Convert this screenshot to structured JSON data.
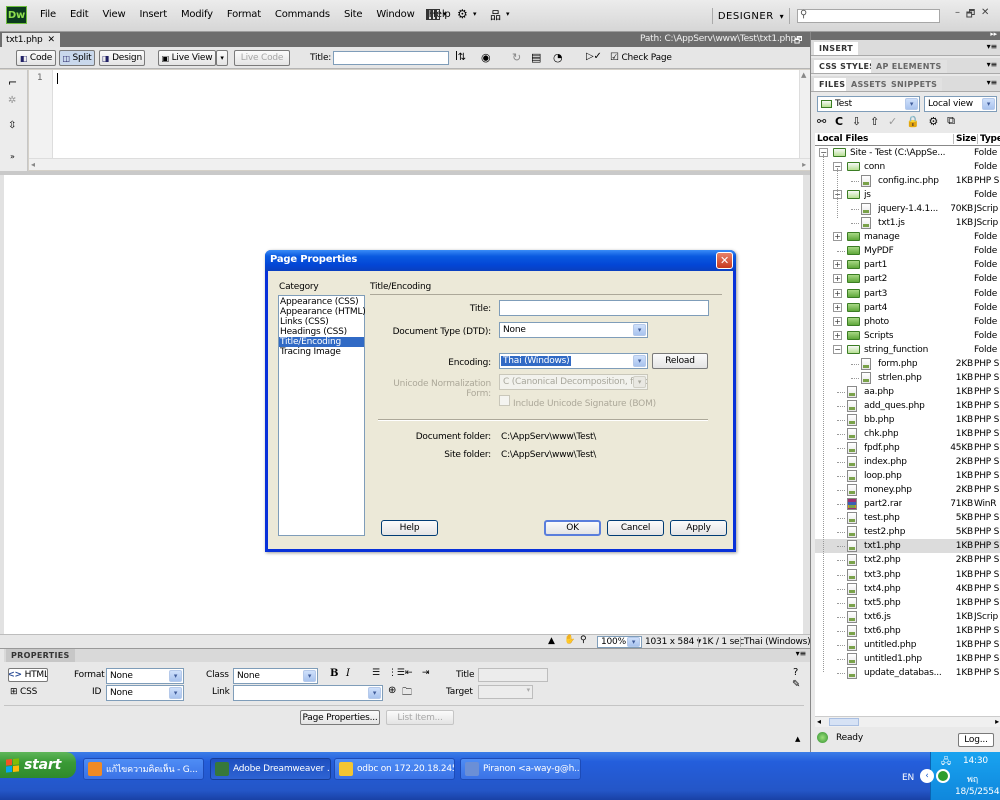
{
  "app": {
    "logo": "Dw",
    "menu": [
      "File",
      "Edit",
      "View",
      "Insert",
      "Modify",
      "Format",
      "Commands",
      "Site",
      "Window",
      "Help"
    ],
    "workspace": "DESIGNER",
    "window_controls": [
      "–",
      "🗗",
      "✕"
    ]
  },
  "document": {
    "tab_name": "txt1.php",
    "path": "Path:  C:\\AppServ\\www\\Test\\txt1.php",
    "view_buttons": {
      "code": "Code",
      "split": "Split",
      "design": "Design",
      "live_view": "Live View",
      "live_code": "Live Code"
    },
    "title_label": "Title:",
    "title_value": "",
    "check_page": "Check Page",
    "line_number": "1"
  },
  "status_bar": {
    "zoom": "100%",
    "size": "1031 x 584",
    "download": "1K / 1 sec",
    "encoding": "Thai (Windows)"
  },
  "dialog": {
    "title": "Page Properties",
    "category_label": "Category",
    "section_label": "Title/Encoding",
    "categories": [
      "Appearance (CSS)",
      "Appearance (HTML)",
      "Links (CSS)",
      "Headings (CSS)",
      "Title/Encoding",
      "Tracing Image"
    ],
    "selected_category": 4,
    "title_label": "Title:",
    "title_value": "",
    "doctype_label": "Document Type (DTD):",
    "doctype_value": "None",
    "encoding_label": "Encoding:",
    "encoding_value": "Thai (Windows)",
    "reload": "Reload",
    "unicode_label": "Unicode Normalization Form:",
    "unicode_value": "C (Canonical Decomposition, follow",
    "bom_label": "Include Unicode Signature (BOM)",
    "doc_folder_label": "Document folder:",
    "doc_folder_value": "C:\\AppServ\\www\\Test\\",
    "site_folder_label": "Site folder:",
    "site_folder_value": "C:\\AppServ\\www\\Test\\",
    "help": "Help",
    "ok": "OK",
    "cancel": "Cancel",
    "apply": "Apply"
  },
  "properties": {
    "header": "PROPERTIES",
    "html_btn": "HTML",
    "css_btn": "CSS",
    "format_label": "Format",
    "format_value": "None",
    "id_label": "ID",
    "id_value": "None",
    "class_label": "Class",
    "class_value": "None",
    "link_label": "Link",
    "title_label": "Title",
    "target_label": "Target",
    "page_properties": "Page Properties...",
    "list_item": "List Item..."
  },
  "panels": {
    "insert": "INSERT",
    "css_styles": "CSS STYLES",
    "ap_elements": "AP ELEMENTS",
    "files": "FILES",
    "assets": "ASSETS",
    "snippets": "SNIPPETS",
    "site_select": "Test",
    "view_select": "Local view",
    "col_local": "Local Files",
    "col_size": "Size",
    "col_type": "Type",
    "ready": "Ready",
    "log": "Log..."
  },
  "files": [
    {
      "name": "Site - Test (C:\\AppSe...",
      "size": "",
      "type": "Folde",
      "depth": 0,
      "kind": "folder-open",
      "exp": "-"
    },
    {
      "name": "conn",
      "size": "",
      "type": "Folde",
      "depth": 1,
      "kind": "folder-open",
      "exp": "-"
    },
    {
      "name": "config.inc.php",
      "size": "1KB",
      "type": "PHP S",
      "depth": 2,
      "kind": "file",
      "exp": ""
    },
    {
      "name": "js",
      "size": "",
      "type": "Folde",
      "depth": 1,
      "kind": "folder-open",
      "exp": "-"
    },
    {
      "name": "jquery-1.4.1...",
      "size": "70KB",
      "type": "JScrip",
      "depth": 2,
      "kind": "file",
      "exp": ""
    },
    {
      "name": "txt1.js",
      "size": "1KB",
      "type": "JScrip",
      "depth": 2,
      "kind": "file",
      "exp": ""
    },
    {
      "name": "manage",
      "size": "",
      "type": "Folde",
      "depth": 1,
      "kind": "folder",
      "exp": "+"
    },
    {
      "name": "MyPDF",
      "size": "",
      "type": "Folde",
      "depth": 1,
      "kind": "folder",
      "exp": ""
    },
    {
      "name": "part1",
      "size": "",
      "type": "Folde",
      "depth": 1,
      "kind": "folder",
      "exp": "+"
    },
    {
      "name": "part2",
      "size": "",
      "type": "Folde",
      "depth": 1,
      "kind": "folder",
      "exp": "+"
    },
    {
      "name": "part3",
      "size": "",
      "type": "Folde",
      "depth": 1,
      "kind": "folder",
      "exp": "+"
    },
    {
      "name": "part4",
      "size": "",
      "type": "Folde",
      "depth": 1,
      "kind": "folder",
      "exp": "+"
    },
    {
      "name": "photo",
      "size": "",
      "type": "Folde",
      "depth": 1,
      "kind": "folder",
      "exp": "+"
    },
    {
      "name": "Scripts",
      "size": "",
      "type": "Folde",
      "depth": 1,
      "kind": "folder",
      "exp": "+"
    },
    {
      "name": "string_function",
      "size": "",
      "type": "Folde",
      "depth": 1,
      "kind": "folder-open",
      "exp": "-"
    },
    {
      "name": "form.php",
      "size": "2KB",
      "type": "PHP S",
      "depth": 2,
      "kind": "file",
      "exp": ""
    },
    {
      "name": "strlen.php",
      "size": "1KB",
      "type": "PHP S",
      "depth": 2,
      "kind": "file",
      "exp": ""
    },
    {
      "name": "aa.php",
      "size": "1KB",
      "type": "PHP S",
      "depth": 1,
      "kind": "file",
      "exp": ""
    },
    {
      "name": "add_ques.php",
      "size": "1KB",
      "type": "PHP S",
      "depth": 1,
      "kind": "file",
      "exp": ""
    },
    {
      "name": "bb.php",
      "size": "1KB",
      "type": "PHP S",
      "depth": 1,
      "kind": "file",
      "exp": ""
    },
    {
      "name": "chk.php",
      "size": "1KB",
      "type": "PHP S",
      "depth": 1,
      "kind": "file",
      "exp": ""
    },
    {
      "name": "fpdf.php",
      "size": "45KB",
      "type": "PHP S",
      "depth": 1,
      "kind": "file",
      "exp": ""
    },
    {
      "name": "index.php",
      "size": "2KB",
      "type": "PHP S",
      "depth": 1,
      "kind": "file",
      "exp": ""
    },
    {
      "name": "loop.php",
      "size": "1KB",
      "type": "PHP S",
      "depth": 1,
      "kind": "file",
      "exp": ""
    },
    {
      "name": "money.php",
      "size": "2KB",
      "type": "PHP S",
      "depth": 1,
      "kind": "file",
      "exp": ""
    },
    {
      "name": "part2.rar",
      "size": "71KB",
      "type": "WinR",
      "depth": 1,
      "kind": "rar",
      "exp": ""
    },
    {
      "name": "test.php",
      "size": "5KB",
      "type": "PHP S",
      "depth": 1,
      "kind": "file",
      "exp": ""
    },
    {
      "name": "test2.php",
      "size": "5KB",
      "type": "PHP S",
      "depth": 1,
      "kind": "file",
      "exp": ""
    },
    {
      "name": "txt1.php",
      "size": "1KB",
      "type": "PHP S",
      "depth": 1,
      "kind": "file",
      "exp": "",
      "selected": true
    },
    {
      "name": "txt2.php",
      "size": "2KB",
      "type": "PHP S",
      "depth": 1,
      "kind": "file",
      "exp": ""
    },
    {
      "name": "txt3.php",
      "size": "1KB",
      "type": "PHP S",
      "depth": 1,
      "kind": "file",
      "exp": ""
    },
    {
      "name": "txt4.php",
      "size": "4KB",
      "type": "PHP S",
      "depth": 1,
      "kind": "file",
      "exp": ""
    },
    {
      "name": "txt5.php",
      "size": "1KB",
      "type": "PHP S",
      "depth": 1,
      "kind": "file",
      "exp": ""
    },
    {
      "name": "txt6.js",
      "size": "1KB",
      "type": "JScrip",
      "depth": 1,
      "kind": "file",
      "exp": ""
    },
    {
      "name": "txt6.php",
      "size": "1KB",
      "type": "PHP S",
      "depth": 1,
      "kind": "file",
      "exp": ""
    },
    {
      "name": "untitled.php",
      "size": "1KB",
      "type": "PHP S",
      "depth": 1,
      "kind": "file",
      "exp": ""
    },
    {
      "name": "untitled1.php",
      "size": "1KB",
      "type": "PHP S",
      "depth": 1,
      "kind": "file",
      "exp": ""
    },
    {
      "name": "update_databas...",
      "size": "1KB",
      "type": "PHP S",
      "depth": 1,
      "kind": "file",
      "exp": ""
    }
  ],
  "taskbar": {
    "start": "start",
    "tasks": [
      {
        "label": "แก้ไขความคิดเห็น - G...",
        "color": "#f08a24"
      },
      {
        "label": "Adobe Dreamweaver ...",
        "color": "#37783a"
      },
      {
        "label": "odbc on 172.20.18.245",
        "color": "#f3c531"
      },
      {
        "label": "Piranon <a-way-g@h...",
        "color": "#6b8fd6"
      }
    ],
    "lang": "EN",
    "time": "14:30",
    "day": "พฤ",
    "date": "18/5/2554"
  }
}
